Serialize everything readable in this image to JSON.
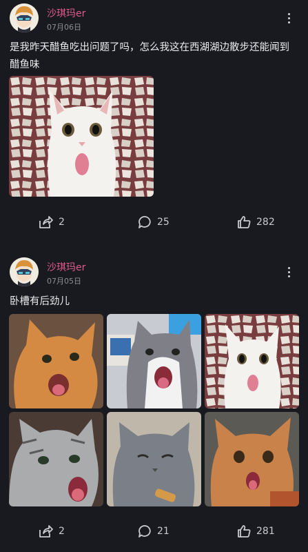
{
  "posts": [
    {
      "username": "沙琪玛er",
      "date": "07月06日",
      "content": "是我昨天醋鱼吃出问题了吗，怎么我这在西湖湖边散步还能闻到醋鱼味",
      "share_count": "2",
      "comment_count": "25",
      "like_count": "282"
    },
    {
      "username": "沙琪玛er",
      "date": "07月05日",
      "content": "卧槽有后劲儿",
      "share_count": "2",
      "comment_count": "21",
      "like_count": "281"
    }
  ],
  "icons": {
    "share": "share-icon",
    "comment": "comment-icon",
    "like": "thumbs-up-icon",
    "more": "more-vertical-icon"
  },
  "colors": {
    "background": "#181a1f",
    "username": "#e05a8c",
    "text": "#ececee",
    "meta": "#8c8f96"
  }
}
